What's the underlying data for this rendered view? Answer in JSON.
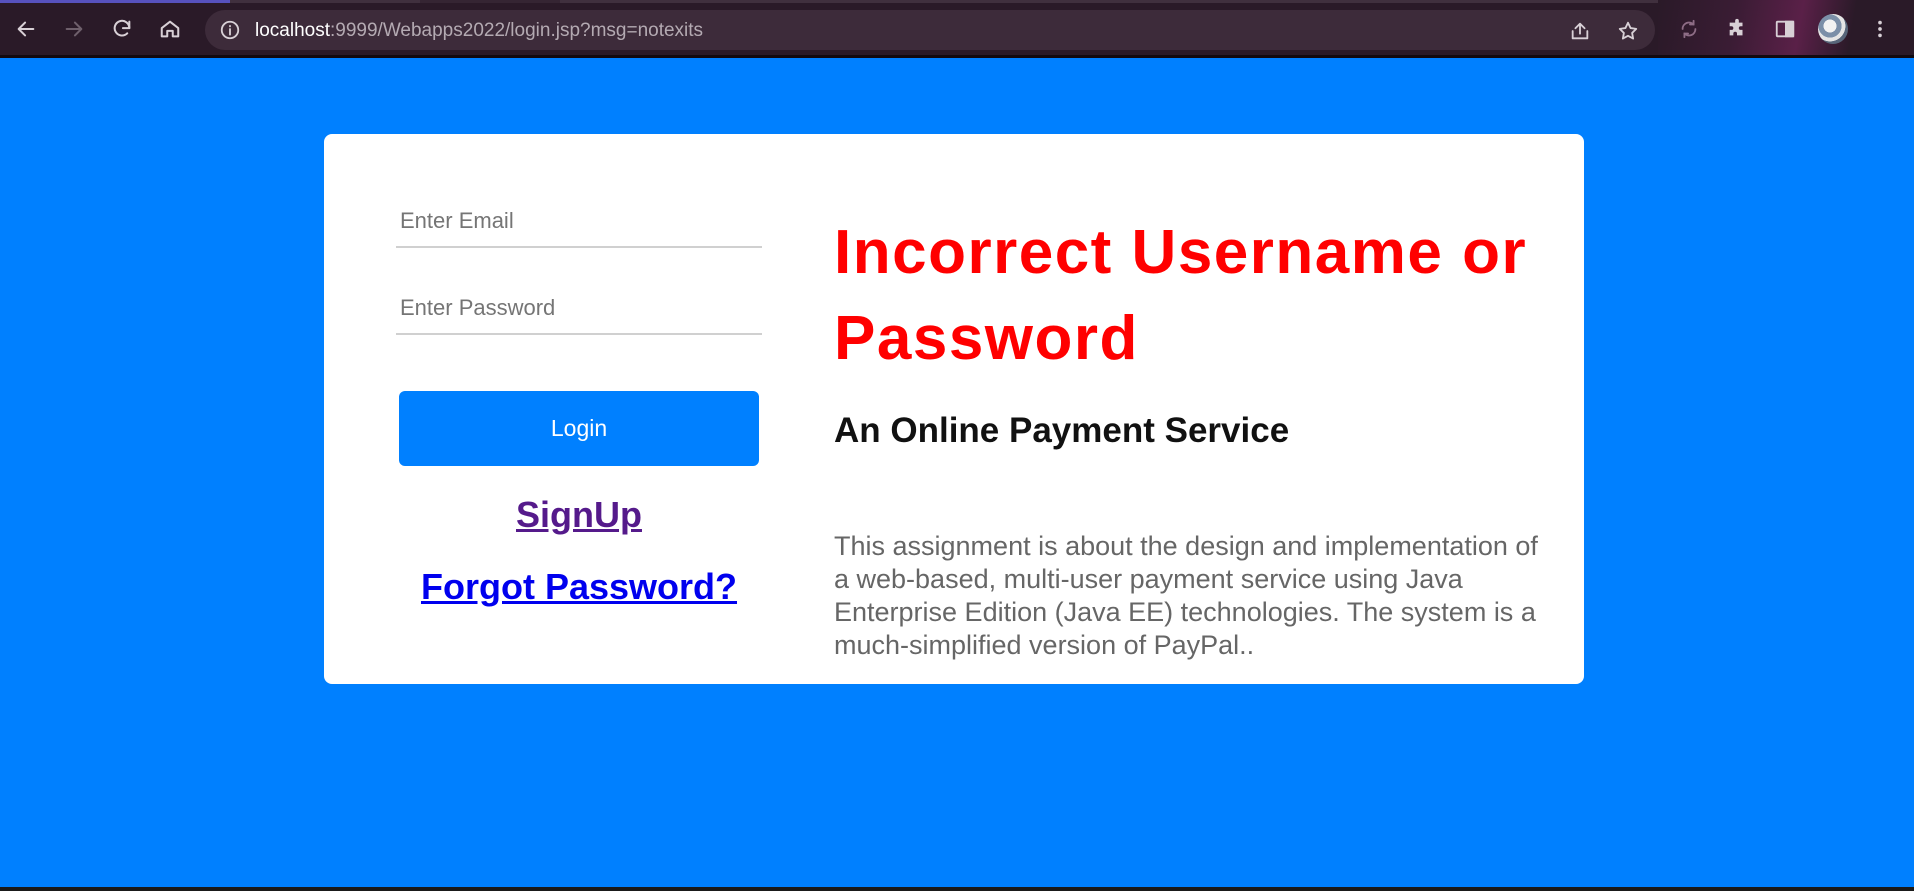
{
  "browser": {
    "url_host": "localhost",
    "url_rest": ":9999/Webapps2022/login.jsp?msg=notexits",
    "icons": {
      "back": "arrow-left-icon",
      "forward": "arrow-right-icon",
      "reload": "reload-icon",
      "home": "home-icon",
      "site_info": "info-icon",
      "share": "share-icon",
      "bookmark": "star-icon",
      "sync": "sync-icon",
      "extensions": "puzzle-icon",
      "side_panel": "side-panel-icon",
      "menu": "kebab-menu-icon"
    }
  },
  "login_form": {
    "email_placeholder": "Enter Email",
    "email_value": "",
    "password_placeholder": "Enter Password",
    "password_value": "",
    "login_label": "Login",
    "signup_label": "SignUp",
    "forgot_label": "Forgot Password?"
  },
  "info": {
    "error_message": "Incorrect Username or Password",
    "subheading": "An Online Payment Service",
    "description": "This assignment is about the design and implementation of a web-based, multi-user payment service using Java Enterprise Edition (Java EE) technologies. The system is a much-simplified version of PayPal.."
  },
  "colors": {
    "page_background": "#0080ff",
    "button": "#0080ff",
    "error": "#ff0000",
    "visited_link": "#551a8b",
    "link": "#0000ee"
  }
}
